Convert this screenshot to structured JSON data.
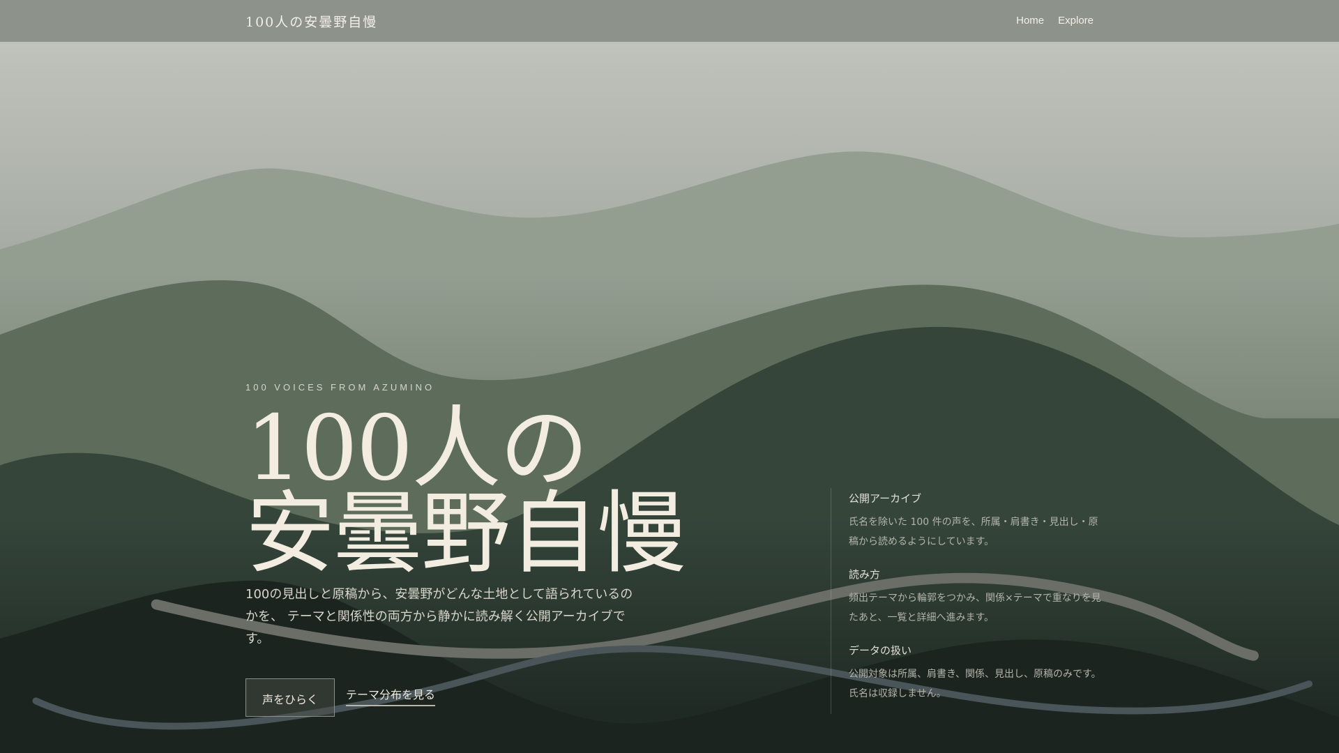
{
  "header": {
    "brand": "100人の安曇野自慢",
    "nav": [
      {
        "label": "Home"
      },
      {
        "label": "Explore"
      }
    ]
  },
  "hero": {
    "eyebrow": "100 VOICES FROM AZUMINO",
    "title_line1": "100人の",
    "title_line2": "安曇野自慢",
    "lead": "100の見出しと原稿から、安曇野がどんな土地として語られているのかを、 テーマと関係性の両方から静かに読み解く公開アーカイブです。",
    "primary_button": "声をひらく",
    "secondary_link": "テーマ分布を見る"
  },
  "side": [
    {
      "heading": "公開アーカイブ",
      "body": "氏名を除いた 100 件の声を、所属・肩書き・見出し・原稿から読めるようにしています。"
    },
    {
      "heading": "読み方",
      "body": "頻出テーマから輪郭をつかみ、関係×テーマで重なりを見たあと、一覧と詳細へ進みます。"
    },
    {
      "heading": "データの扱い",
      "body": "公開対象は所属、肩書き、関係、見出し、原稿のみです。氏名は収録しません。"
    }
  ]
}
